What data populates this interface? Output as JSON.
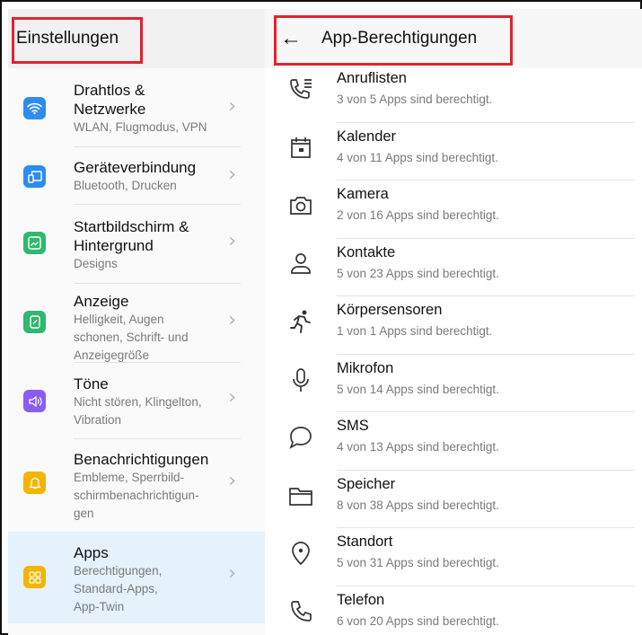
{
  "left": {
    "title": "Einstellungen",
    "items": [
      {
        "title1": "Drahtlos &",
        "title2": "Netzwerke",
        "sub1": "WLAN, Flugmodus, VPN",
        "icon": "wifi-icon",
        "color": "#2d8cf0"
      },
      {
        "title1": "Geräteverbindung",
        "sub1": "Bluetooth, Drucken",
        "icon": "device-connection-icon",
        "color": "#2d8cf0"
      },
      {
        "title1": "Startbildschirm &",
        "title2": "Hintergrund",
        "sub1": "Designs",
        "icon": "home-screen-icon",
        "color": "#2fb86e"
      },
      {
        "title1": "Anzeige",
        "sub1": "Helligkeit, Augen",
        "sub2": "schonen, Schrift- und",
        "sub3": "Anzeigegröße",
        "icon": "display-icon",
        "color": "#2fb86e"
      },
      {
        "title1": "Töne",
        "sub1": "Nicht stören, Klingelton,",
        "sub2": "Vibration",
        "icon": "sound-icon",
        "color": "#8a5cf6"
      },
      {
        "title1": "Benachrichtigungen",
        "sub1": "Embleme, Sperrbild-",
        "sub2": "schirmbenachrichtigun-",
        "sub3": "gen",
        "icon": "bell-icon",
        "color": "#f4b400"
      },
      {
        "title1": "Apps",
        "sub1": "Berechtigungen,",
        "sub2": "Standard-Apps,",
        "sub3": "App-Twin",
        "icon": "apps-icon",
        "color": "#f4b400"
      }
    ],
    "chevron": "›"
  },
  "right": {
    "back": "←",
    "title": "App-Berechtigungen",
    "items": [
      {
        "title": "Anruflisten",
        "sub": "3 von 5 Apps sind berechtigt.",
        "icon": "call-log-icon"
      },
      {
        "title": "Kalender",
        "sub": "4 von 11 Apps sind berechtigt.",
        "icon": "calendar-icon"
      },
      {
        "title": "Kamera",
        "sub": "2 von 16 Apps sind berechtigt.",
        "icon": "camera-icon"
      },
      {
        "title": "Kontakte",
        "sub": "5 von 23 Apps sind berechtigt.",
        "icon": "contacts-icon"
      },
      {
        "title": "Körpersensoren",
        "sub": "1 von 1 Apps sind berechtigt.",
        "icon": "body-sensor-icon"
      },
      {
        "title": "Mikrofon",
        "sub": "5 von 14 Apps sind berechtigt.",
        "icon": "microphone-icon"
      },
      {
        "title": "SMS",
        "sub": "4 von 13 Apps sind berechtigt.",
        "icon": "sms-icon"
      },
      {
        "title": "Speicher",
        "sub": "8 von 38 Apps sind berechtigt.",
        "icon": "folder-icon"
      },
      {
        "title": "Standort",
        "sub": "5 von 31 Apps sind berechtigt.",
        "icon": "location-icon"
      },
      {
        "title": "Telefon",
        "sub": "6 von 20 Apps sind berechtigt.",
        "icon": "phone-icon"
      }
    ]
  },
  "colors": {
    "highlight": "#e0242f",
    "active_bg": "#e5f1fb"
  }
}
